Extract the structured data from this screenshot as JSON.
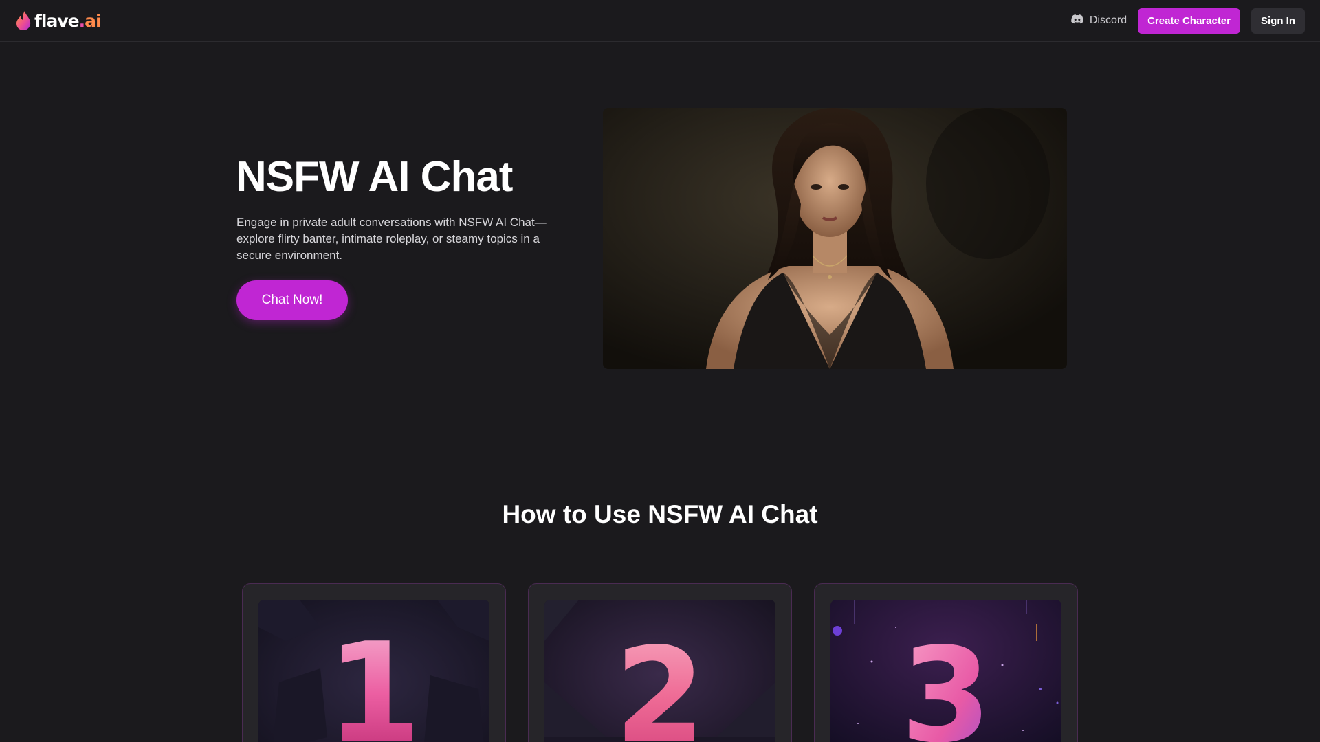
{
  "navbar": {
    "logo_text": "flave",
    "logo_dot": ".",
    "logo_suffix": "ai",
    "discord_label": "Discord",
    "create_label": "Create Character",
    "signin_label": "Sign In"
  },
  "hero": {
    "title": "NSFW AI Chat",
    "description": "Engage in private adult conversations with NSFW AI Chat—explore flirty banter, intimate roleplay, or steamy topics in a secure environment.",
    "cta_label": "Chat Now!"
  },
  "how_to": {
    "title": "How to Use NSFW AI Chat",
    "steps": [
      {
        "number": "1"
      },
      {
        "number": "2"
      },
      {
        "number": "3"
      }
    ]
  },
  "colors": {
    "background": "#1b1a1d",
    "accent": "#c026d3",
    "card_border": "#4a2b52",
    "signin_bg": "#2f2e33"
  },
  "icons": {
    "logo": "flame-icon",
    "discord": "discord-icon"
  }
}
